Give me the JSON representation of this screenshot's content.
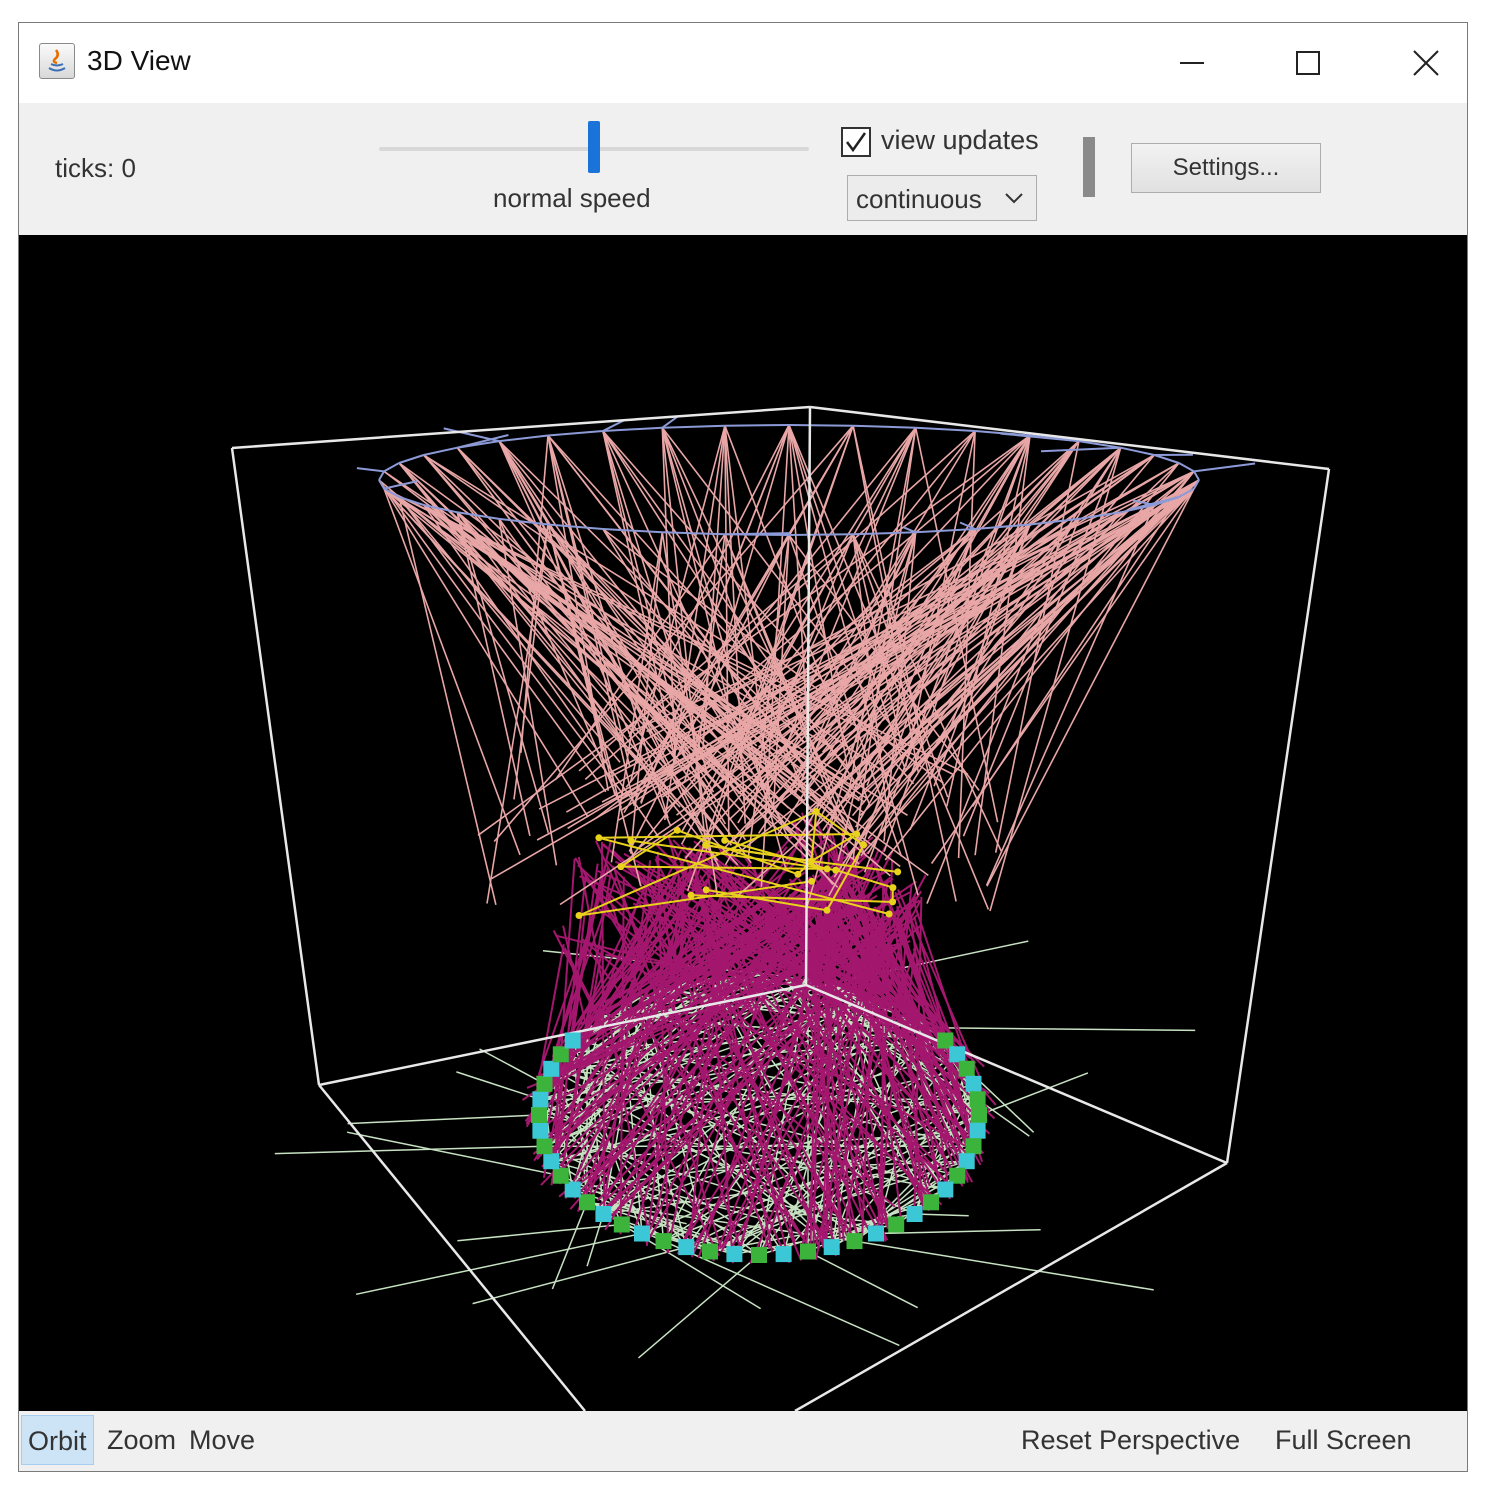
{
  "window": {
    "title": "3D View"
  },
  "toolbar": {
    "ticks_label": "ticks: 0",
    "speed_label": "normal speed",
    "speed_value": 0.5,
    "view_updates_label": "view updates",
    "view_updates_checked": true,
    "update_mode_value": "continuous",
    "settings_label": "Settings..."
  },
  "bottombar": {
    "modes": [
      "Orbit",
      "Zoom",
      "Move"
    ],
    "active_mode": "Orbit",
    "reset_label": "Reset Perspective",
    "fullscreen_label": "Full Screen"
  },
  "colors": {
    "accent": "#1a73d9",
    "box": "#e8e8e8",
    "top_ring": "#8c9ad8",
    "upper_links": "#e8a6a6",
    "lower_links": "#a3176e",
    "middle_nodes": "#e8d21c",
    "base_links": "#c7e2c2",
    "base_nodes_green": "#3cb43c",
    "base_nodes_cyan": "#3cc7d6"
  }
}
